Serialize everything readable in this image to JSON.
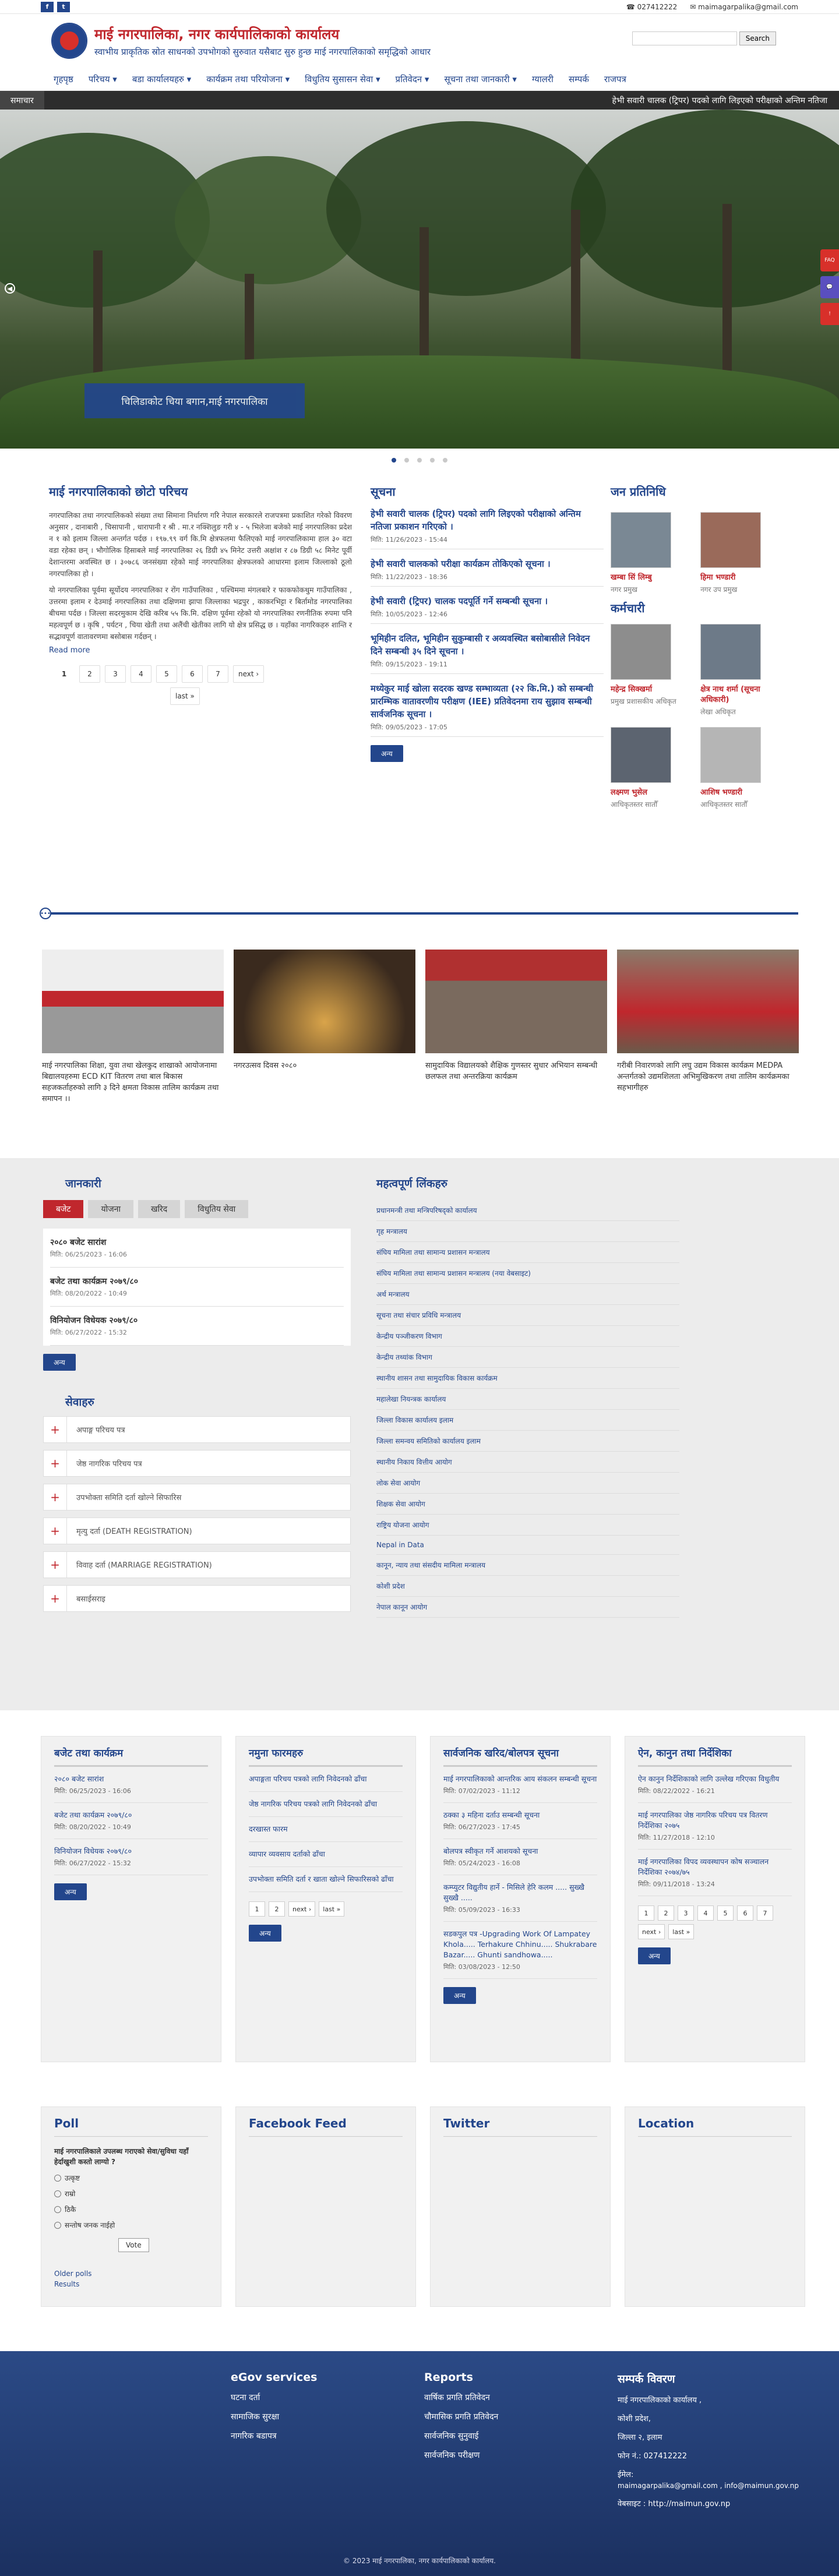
{
  "topbar": {
    "phone": "027412222",
    "email": "maimagarpalika@gmail.com"
  },
  "header": {
    "title": "माई नगरपालिका, नगर कार्यपालिकाको कार्यालय",
    "subtitle": "स्वाभीय प्राकृतिक स्रोत साधनको उपभोगको सुरुवात यसैबाट सुरु हुन्छ माई नगरपालिकाको समृद्धिको आधार",
    "search_placeholder": "",
    "search_button": "Search"
  },
  "nav": [
    "गृहपृष्ठ",
    "परिचय ▾",
    "बडा कार्यालयहरु ▾",
    "कार्यक्रम तथा परियोजना ▾",
    "विधुतिय सुसासन सेवा ▾",
    "प्रतिवेदन ▾",
    "सूचना तथा जानकारी ▾",
    "ग्यालरी",
    "सम्पर्क",
    "राजपत्र"
  ],
  "ticker": {
    "label": "समाचार",
    "message": "हेभी सवारी चालक (ट्रिपर) पदको लागि लिइएको परीक्षाको अन्तिम नतिजा"
  },
  "hero": {
    "caption": "चिलिडाकोट चिया बगान,माई नगरपालिका"
  },
  "side_badges": [
    "FAQ",
    "💬",
    "!"
  ],
  "intro": {
    "title": "माई नगरपालिकाको छोटो परिचय",
    "p1": "नगरपालिका तथा नगरपालिकको संख्या तथा सिमाना निर्धारण गरि नेपाल सरकारले राजपत्रमा प्रकाशित गरेको विवरण अनुसार , दानाबारी , चिसापानी , धारापानी र श्री . मा.र नक्शिलुङ गरी ४ - ५ भिलेजा बजेको माई नगरपालिका प्रदेश न १ को इलाम जिल्ला अन्तर्गत पर्दछ । १९७.९९ वर्ग कि.मि क्षेत्रफलमा फैलिएको माई नगरपालिकामा हाल ३० वटा वडा रहेका छन् । भौगोलिक हिसाबले माई नगरपालिका २६ डिग्री ४५ मिनेट उत्तरी अक्षांश र ८७ डिग्री ५८ मिनेट पूर्वी देशान्तरमा अवस्थित छ । ३०७८६ जनसंख्या रहेको माई नगरपालिका क्षेत्रफलको आधारमा इलाम जिल्लाको ठूलो नगरपालिका हो ।",
    "p2": "यो नगरपालिका पूर्वमा सूर्योदय नगरपालिका र रोंग गाउँपालिका , पश्चिममा मंगलबारे र फाकफोकथुम गाउँपालिका , उत्तरमा इलाम र देउमाई नगरपालिका तथा दक्षिणमा झापा जिल्लाका भद्रपुर , काकरभिट्टा र बिर्तामोड नगरपालिका बीचमा पर्दछ । जिल्ला सदरमुकाम देखि करिब ५५ कि.मि. दक्षिण पूर्वमा रहेको यो नगरपालिका रणनीतिक रुपमा पनि महत्वपूर्ण छ । कृषि , पर्यटन , चिया खेती तथा अलैंची खेतीका लागि यो क्षेत्र प्रसिद्ध छ । यहाँका नागरिकहरु शान्ति र सद्भावपूर्ण वातावरणमा बसोबास गर्दछन् ।",
    "read_more": "Read more"
  },
  "intro_pager": [
    "1",
    "2",
    "3",
    "4",
    "5",
    "6",
    "7",
    "next ›",
    "last »"
  ],
  "notices": {
    "title": "सूचना",
    "items": [
      {
        "t": "हेभी सवारी चालक (ट्रिपर) पदको लागि लिइएको परीक्षाको अन्तिम नतिजा प्रकाशन गरिएको ।",
        "d": "मिति: 11/26/2023 - 15:44"
      },
      {
        "t": "हेभी सवारी चालकको परीक्षा कार्यक्रम तोकिएको सूचना ।",
        "d": "मिति: 11/22/2023 - 18:36"
      },
      {
        "t": "हेभी सवारी (ट्रिपर) चालक पदपूर्ति गर्ने सम्बन्धी सूचना ।",
        "d": "मिति: 10/05/2023 - 12:46"
      },
      {
        "t": "भूमिहीन दलित, भूमिहीन सुकुम्बासी र अव्यवस्थित बसोबासीले निवेदन दिने सम्बन्धी ३५ दिने सूचना ।",
        "d": "मिति: 09/15/2023 - 19:11"
      },
      {
        "t": "मध्येकुर माई खोला सदरक खण्ड सम्भाव्यता (२२ कि.मि.) को सम्बन्धी प्रारम्भिक वातावरणीय परीक्षण (IEE) प्रतिवेदनमा राय सुझाव सम्बन्धी सार्वजनिक सूचना ।",
        "d": "मिति: 09/05/2023 - 17:05"
      }
    ],
    "more": "अन्य"
  },
  "reps": {
    "title": "जन प्रतिनिधि",
    "staff_title": "कर्मचारी",
    "people": [
      {
        "n": "खम्बा सिं लिम्बु",
        "r": "नगर प्रमुख"
      },
      {
        "n": "हिमा भण्डारी",
        "r": "नगर उप प्रमुख"
      }
    ],
    "staff": [
      {
        "n": "महेन्द्र सिक्खर्मा",
        "r": "प्रमुख प्रशासकीय अधिकृत"
      },
      {
        "n": "क्षेत्र नाथ शर्मा (सूचना अधिकारी)",
        "r": "लेखा अधिकृत"
      },
      {
        "n": "लक्ष्मण भुसेल",
        "r": "आधिकृतस्तर सातौँ"
      },
      {
        "n": "आशिष भण्डारी",
        "r": "आधिकृतस्तर सातौँ"
      }
    ]
  },
  "gallery": [
    {
      "c": "माई नगरपालिका शिक्षा, युवा तथा खेलकुद शाखाको आयोजनामा बिद्यालयहरुमा ECD KIT वितरण तथा बाल बिकास सहजकर्ताहरुको लागि ३ दिने क्षमता विकास तालिम कार्यक्रम तथा समापन ।।"
    },
    {
      "c": "नगरउत्सव दिवस २०८०"
    },
    {
      "c": "सामुदायिक विद्यालयको शैक्षिक गुणस्तर सुधार अभियान सम्बन्धी छलफल तथा अन्तरक्रिया कार्यक्रम"
    },
    {
      "c": "गरीबी निवारणको लागि लघु उद्यम विकास कार्यक्रम MEDPA अन्तर्गतको उद्यमशिलता अभिमुखिकरण तथा तालिम कार्यक्रमका सहभागीहरु"
    }
  ],
  "info": {
    "title": "जानकारी",
    "tabs": [
      "बजेट",
      "योजना",
      "खरिद",
      "विधुतिय सेवा"
    ],
    "items": [
      {
        "t": "२०८० बजेट सारांश",
        "d": "मिति: 06/25/2023 - 16:06"
      },
      {
        "t": "बजेट तथा कार्यक्रम २०७९/८०",
        "d": "मिति: 08/20/2022 - 10:49"
      },
      {
        "t": "विनियोजन विधेयक २०७९/८०",
        "d": "मिति: 06/27/2022 - 15:32"
      }
    ],
    "more": "अन्य"
  },
  "services": {
    "title": "सेवाहरु",
    "items": [
      "अपाङ्ग परिचय पत्र",
      "जेष्ठ नागरिक परिचय पत्र",
      "उपभोक्ता समिति दर्ता खोल्ने सिफारिस",
      "मृत्यु दर्ता (DEATH REGISTRATION)",
      "विवाह दर्ता (MARRIAGE REGISTRATION)",
      "बसाईसराइ"
    ]
  },
  "links": {
    "title": "महत्वपूर्ण लिंकहरु",
    "items": [
      "प्रधानमन्त्री तथा मन्त्रिपरिषद्को कार्यालय",
      "गृह मन्त्रालय",
      "संघिय मामिला तथा सामान्य प्रशासन मन्त्रालय",
      "संघिय मामिला तथा सामान्य प्रशासन मन्त्रालय (नया वेबसाइट)",
      "अर्थ मन्त्रालय",
      "सूचना तथा संचार प्रविधि मन्त्रालय",
      "केन्द्रीय पञ्जीकरण विभाग",
      "केन्द्रीय तथ्यांक विभाग",
      "स्थानीय शासन तथा सामुदायिक विकास कार्यक्रम",
      "महालेखा नियन्त्रक कार्यालय",
      "जिल्ला विकास कार्यालय इलाम",
      "जिल्ला समन्वय समितिको कार्यालय इलाम",
      "स्थानीय निकाय वित्तीय आयोग",
      "लोक सेवा आयोग",
      "शिक्षक सेवा आयोग",
      "राष्ट्रिय योजना आयोग",
      "Nepal in Data",
      "कानून, न्याय तथा संसदीय मामिला मन्त्रालय",
      "कोशी प्रदेश",
      "नेपाल कानून आयोग"
    ]
  },
  "box_budget": {
    "title": "बजेट तथा कार्यक्रम",
    "items": [
      {
        "t": "२०८० बजेट सारांश",
        "d": "मिति: 06/25/2023 - 16:06"
      },
      {
        "t": "बजेट तथा कार्यक्रम २०७९/८०",
        "d": "मिति: 08/20/2022 - 10:49"
      },
      {
        "t": "विनियोजन विधेयक २०७९/८०",
        "d": "मिति: 06/27/2022 - 15:32"
      }
    ],
    "more": "अन्य"
  },
  "box_forms": {
    "title": "नमुना फारमहरु",
    "items": [
      "अपाङ्गता परिचय पत्रको लागि निवेदनको ढाँचा",
      "जेष्ठ नागरिक परिचय पत्रको लागि निवेदनको ढाँचा",
      "दरखास्त फारम",
      "व्यापार व्यवसाय दर्ताको ढाँचा",
      "उपभोक्ता समिति दर्ता र खाता खोल्ने सिफारिसको ढाँचा"
    ],
    "pager": [
      "1",
      "2",
      "next ›",
      "last »"
    ],
    "more": "अन्य"
  },
  "box_procure": {
    "title": "सार्वजनिक खरिद/बोलपत्र सूचना",
    "items": [
      {
        "t": "माई नगरपालिकाको आन्तरिक आय संकलन सम्बन्धी सूचना",
        "d": "मिति: 07/02/2023 - 11:12"
      },
      {
        "t": "ठक्का ३ महिना दर्ताउ सम्बन्धी सूचना",
        "d": "मिति: 06/27/2023 - 17:45"
      },
      {
        "t": "बोलपत्र स्वीकृत गर्ने आशयको सूचना",
        "d": "मिति: 05/24/2023 - 16:08"
      },
      {
        "t": "कम्प्युटर विद्युतीय हार्ने - मिसिले हेरि कलम ..... सुख्खै सुख्खै .....",
        "d": "मिति: 05/09/2023 - 16:33"
      },
      {
        "t": "सडकपुल पत्र -Upgrading Work Of Lampatey Khola..... Terhakure Chhinu..... Shukrabare Bazar..... Ghunti sandhowa.....",
        "d": "मिति: 03/08/2023 - 12:50"
      }
    ],
    "more": "अन्य"
  },
  "box_laws": {
    "title": "ऐन, कानुन तथा निर्देशिका",
    "items": [
      {
        "t": "ऐन कानुन निर्देशिकाको लागि उल्लेख गरिएका विधुतीय",
        "d": "मिति: 08/22/2022 - 16:21"
      },
      {
        "t": "माई नगरपालिका जेष्ठ नागरिक परिचय पत्र वितरण निर्देशिका २०७५",
        "d": "मिति: 11/27/2018 - 12:10"
      },
      {
        "t": "माई नगरपालिका विपद व्यवस्थापन कोष सञ्चालन निर्देशिका २०७४/७५",
        "d": "मिति: 09/11/2018 - 13:24"
      }
    ],
    "pager": [
      "1",
      "2",
      "3",
      "4",
      "5",
      "6",
      "7",
      "next ›",
      "last »"
    ],
    "more": "अन्य"
  },
  "poll": {
    "title": "Poll",
    "question": "माई नगरपालिकाले उपलब्ध गराएको सेवा/सुविधा यहाँ हेर्दाखुशी कस्तो लाग्यो ?",
    "options": [
      "उत्कृष्ट",
      "राम्रो",
      "ठिकै",
      "सन्तोष जनक नाईहो"
    ],
    "vote": "Vote",
    "older": "Older polls",
    "results": "Results"
  },
  "facebook": {
    "title": "Facebook Feed"
  },
  "twitter": {
    "title": "Twitter"
  },
  "location": {
    "title": "Location"
  },
  "footer": {
    "egov": "eGov services",
    "egov_items": [
      "घटना दर्ता",
      "सामाजिक सुरक्षा",
      "नागरिक बडापत्र"
    ],
    "reports": "Reports",
    "report_items": [
      "वार्षिक प्रगति प्रतिवेदन",
      "चौमासिक प्रगति प्रतिवेदन",
      "सार्वजनिक सुनुवाई",
      "सार्वजनिक परीक्षण"
    ],
    "contact": "सम्पर्क विवरण",
    "contact_items": [
      "माई नगरपालिकाको कार्यालय ,",
      "कोशी प्रदेश,",
      "जिल्ला २, इलाम",
      "फोन नं.: 027412222",
      "ईमेल:",
      "maimagarpalika@gmail.com , info@maimun.gov.np",
      "वेबसाइट : http://maimun.gov.np"
    ],
    "copyright": "© 2023 माई नगरपालिका, नगर कार्यपालिकाको कार्यालय."
  }
}
